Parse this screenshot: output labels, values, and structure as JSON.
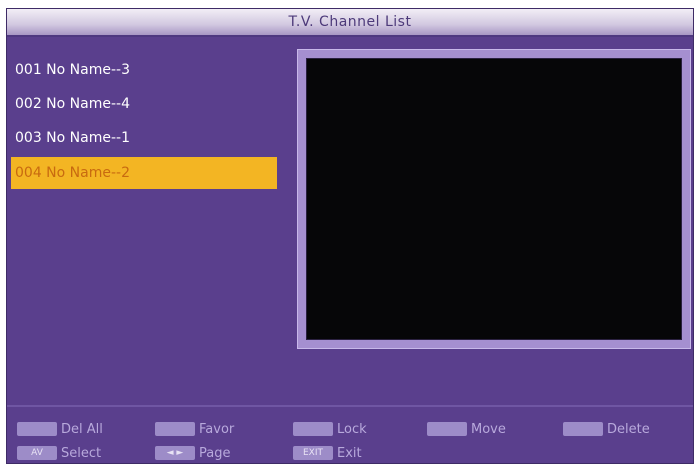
{
  "title": "T.V. Channel List",
  "channels": [
    {
      "label": "001 No Name--3",
      "selected": false
    },
    {
      "label": "002 No Name--4",
      "selected": false
    },
    {
      "label": "003 No Name--1",
      "selected": false
    },
    {
      "label": "004 No Name--2",
      "selected": true
    }
  ],
  "help": {
    "row1": [
      {
        "key": "",
        "label": "Del All"
      },
      {
        "key": "",
        "label": "Favor"
      },
      {
        "key": "",
        "label": "Lock"
      },
      {
        "key": "",
        "label": "Move"
      },
      {
        "key": "",
        "label": "Delete"
      }
    ],
    "row2": [
      {
        "key": "AV",
        "label": "Select"
      },
      {
        "key": "◄ ►",
        "label": "Page"
      },
      {
        "key": "EXIT",
        "label": "Exit"
      }
    ]
  },
  "colors": {
    "background": "#5a3f8d",
    "selection": "#f3b523",
    "text": "#ffffff",
    "preview": "#060608"
  }
}
